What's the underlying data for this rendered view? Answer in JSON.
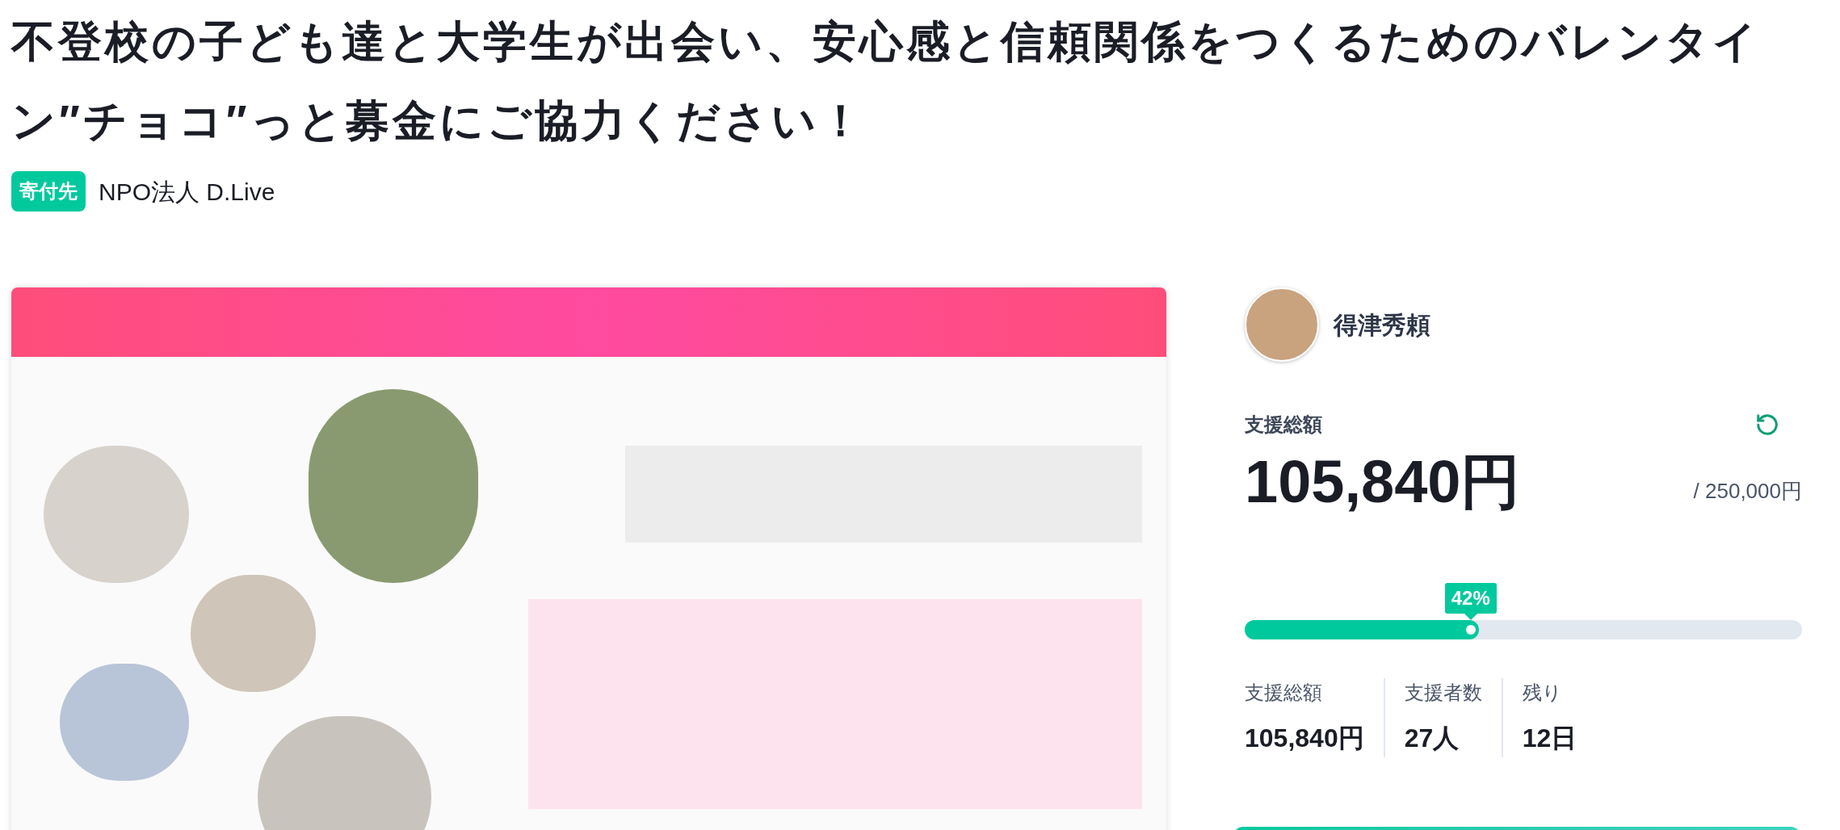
{
  "title": "不登校の子ども達と大学生が出会い、安心感と信頼関係をつくるためのバレンタイン″チョコ″っと募金にご協力ください！",
  "recipient": {
    "badge": "寄付先",
    "name": "NPO法人 D.Live"
  },
  "organizer": {
    "name": "得津秀頼"
  },
  "funding": {
    "label": "支援総額",
    "amount": "105,840円",
    "goal": "/ 250,000円",
    "percent": "42%",
    "level": 0.42
  },
  "stats": [
    {
      "label": "支援総額",
      "value": "105,840円"
    },
    {
      "label": "支援者数",
      "value": "27人"
    },
    {
      "label": "残り",
      "value": "12日"
    }
  ]
}
